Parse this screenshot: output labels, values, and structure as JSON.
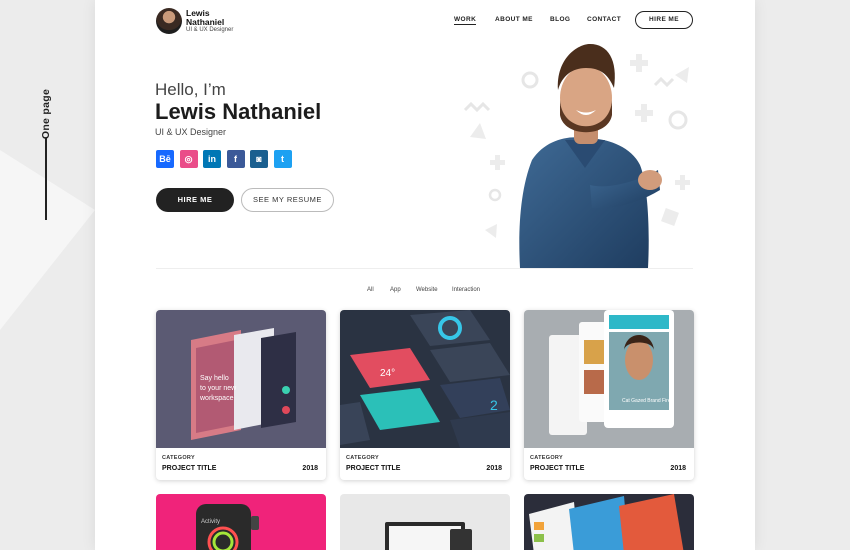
{
  "side": {
    "label": "One page"
  },
  "brand": {
    "name": "Lewis Nathaniel",
    "role": "UI & UX Designer"
  },
  "nav": {
    "items": [
      "WORK",
      "ABOUT ME",
      "BLOG",
      "CONTACT"
    ],
    "cta": "HIRE ME"
  },
  "hero": {
    "hello": "Hello, I’m",
    "name": "Lewis Nathaniel",
    "role": "UI & UX Designer",
    "socials": [
      {
        "icon": "behance-icon",
        "glyph": "Bē",
        "color": "#1769ff"
      },
      {
        "icon": "dribbble-icon",
        "glyph": "◎",
        "color": "#ea4c89"
      },
      {
        "icon": "linkedin-icon",
        "glyph": "in",
        "color": "#0077b5"
      },
      {
        "icon": "facebook-icon",
        "glyph": "f",
        "color": "#3b5998"
      },
      {
        "icon": "instagram-icon",
        "glyph": "◙",
        "color": "#1a5f8f"
      },
      {
        "icon": "twitter-icon",
        "glyph": "t",
        "color": "#1da1f2"
      }
    ],
    "hire_label": "HIRE ME",
    "resume_label": "SEE MY RESUME"
  },
  "filters": [
    "All",
    "App",
    "Website",
    "Interaction"
  ],
  "projects": [
    {
      "category": "CATEGORY",
      "title": "PROJECT TITLE",
      "year": "2018"
    },
    {
      "category": "CATEGORY",
      "title": "PROJECT TITLE",
      "year": "2018"
    },
    {
      "category": "CATEGORY",
      "title": "PROJECT TITLE",
      "year": "2018"
    }
  ]
}
